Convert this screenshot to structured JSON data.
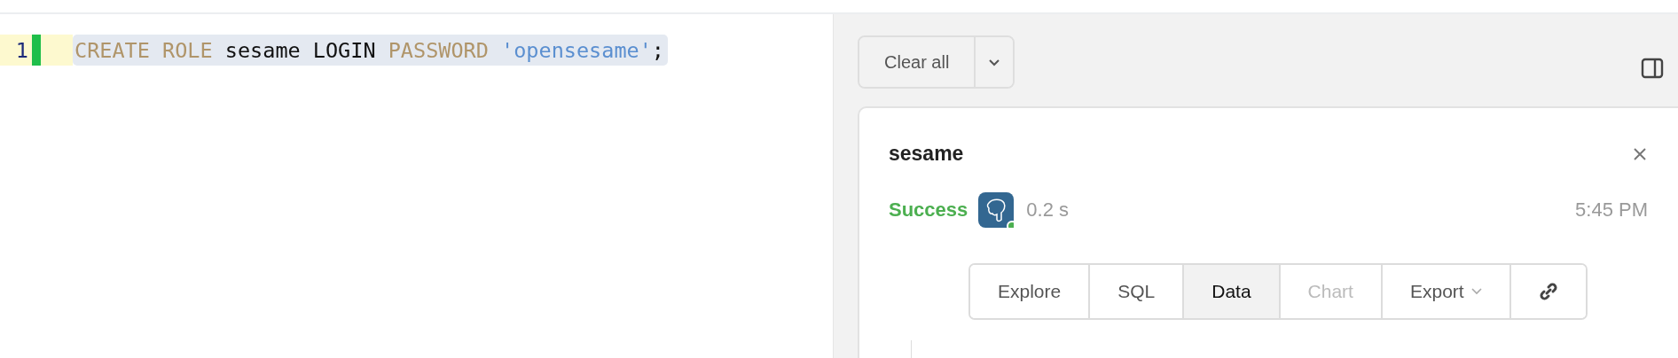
{
  "editor": {
    "lines": [
      {
        "number": "1",
        "changed": true,
        "highlighted": true,
        "tokens": [
          {
            "kind": "keyword",
            "text": "CREATE ROLE"
          },
          {
            "kind": "plain",
            "text": " sesame LOGIN "
          },
          {
            "kind": "keyword",
            "text": "PASSWORD"
          },
          {
            "kind": "string",
            "text": " 'opensesame'"
          },
          {
            "kind": "plain",
            "text": ";"
          }
        ]
      }
    ]
  },
  "results": {
    "clear_button": "Clear all",
    "card": {
      "title": "sesame",
      "status": "Success",
      "online": true,
      "duration": "0.2 s",
      "time": "5:45 PM",
      "tabs": [
        {
          "label": "Explore",
          "selected": false,
          "disabled": false
        },
        {
          "label": "SQL",
          "selected": false,
          "disabled": false
        },
        {
          "label": "Data",
          "selected": true,
          "disabled": false
        },
        {
          "label": "Chart",
          "selected": false,
          "disabled": true
        },
        {
          "label": "Export",
          "selected": false,
          "disabled": false,
          "kind": "dropdown"
        },
        {
          "kind": "link",
          "selected": false,
          "disabled": false
        }
      ]
    }
  }
}
